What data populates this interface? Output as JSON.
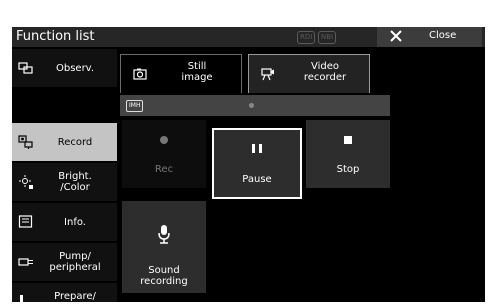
{
  "title_bar": {
    "title": "Function list",
    "badges": [
      "RDI",
      "NBI"
    ],
    "close_label": "Close"
  },
  "sidebar": {
    "items": [
      {
        "label": "Observ.",
        "icon": "observation-icon"
      },
      {
        "label": "Record",
        "icon": "record-icon",
        "active": true
      },
      {
        "label": "Bright.\n/Color",
        "icon": "brightness-icon"
      },
      {
        "label": "Info.",
        "icon": "info-icon"
      },
      {
        "label": "Pump/\nperipheral",
        "icon": "pump-icon"
      },
      {
        "label": "Prepare/\nEnd Exam",
        "icon": "exam-icon"
      }
    ]
  },
  "tabs": [
    {
      "label": "Still\nimage",
      "icon": "camera-icon"
    },
    {
      "label": "Video\nrecorder",
      "icon": "video-recorder-icon",
      "active": true
    }
  ],
  "recorder": {
    "badge": "IMH",
    "controls": {
      "rec": "Rec",
      "pause": "Pause",
      "stop": "Stop",
      "sound": "Sound\nrecording"
    }
  },
  "colors": {
    "background": "#000000",
    "active_sidebar": "#c4c4c4",
    "selected_outline": "#ffffff",
    "button": "#2d2d2d"
  }
}
